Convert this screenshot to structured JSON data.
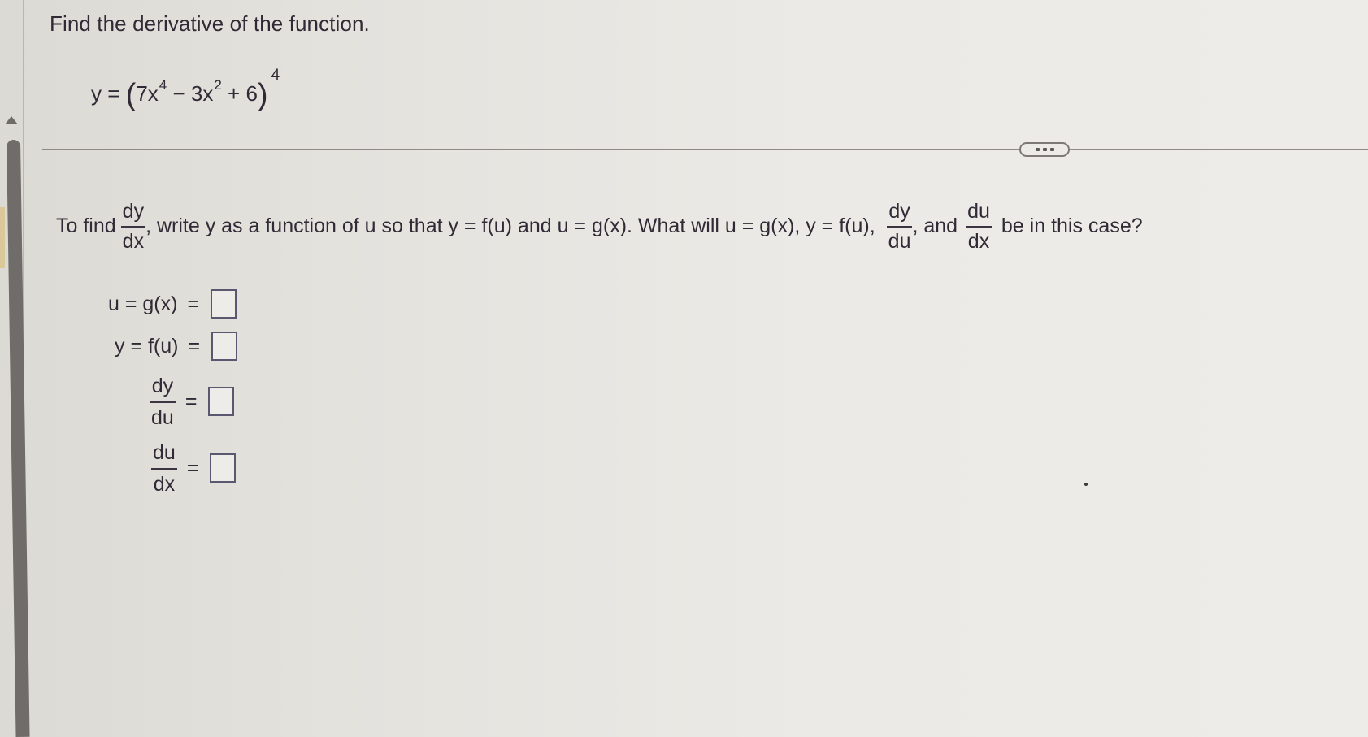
{
  "question": {
    "prompt": "Find the derivative of the function.",
    "equation": {
      "lhs": "y =",
      "open_paren": "(",
      "term1": "7x",
      "term1_exp": "4",
      "op1": " − 3x",
      "term2_exp": "2",
      "op2": " + 6",
      "close_paren": ")",
      "outer_exp": "4"
    }
  },
  "more_button": {
    "icon": "ellipsis-icon"
  },
  "instructions": {
    "part1": "To find",
    "frac1_num": "dy",
    "frac1_den": "dx",
    "part2": ", write y as a function of u so that y = f(u) and u = g(x). What will u = g(x), y = f(u),",
    "frac2_num": "dy",
    "frac2_den": "du",
    "part3": ", and",
    "frac3_num": "du",
    "frac3_den": "dx",
    "part4": "be in this case?"
  },
  "answers": [
    {
      "label": "u = g(x)",
      "eq": "=",
      "value": ""
    },
    {
      "label": "y = f(u)",
      "eq": "=",
      "value": ""
    },
    {
      "num": "dy",
      "den": "du",
      "eq": "=",
      "value": ""
    },
    {
      "num": "du",
      "den": "dx",
      "eq": "=",
      "value": ""
    }
  ],
  "scrollbar": {
    "icon": "scroll-up-arrow-icon"
  }
}
